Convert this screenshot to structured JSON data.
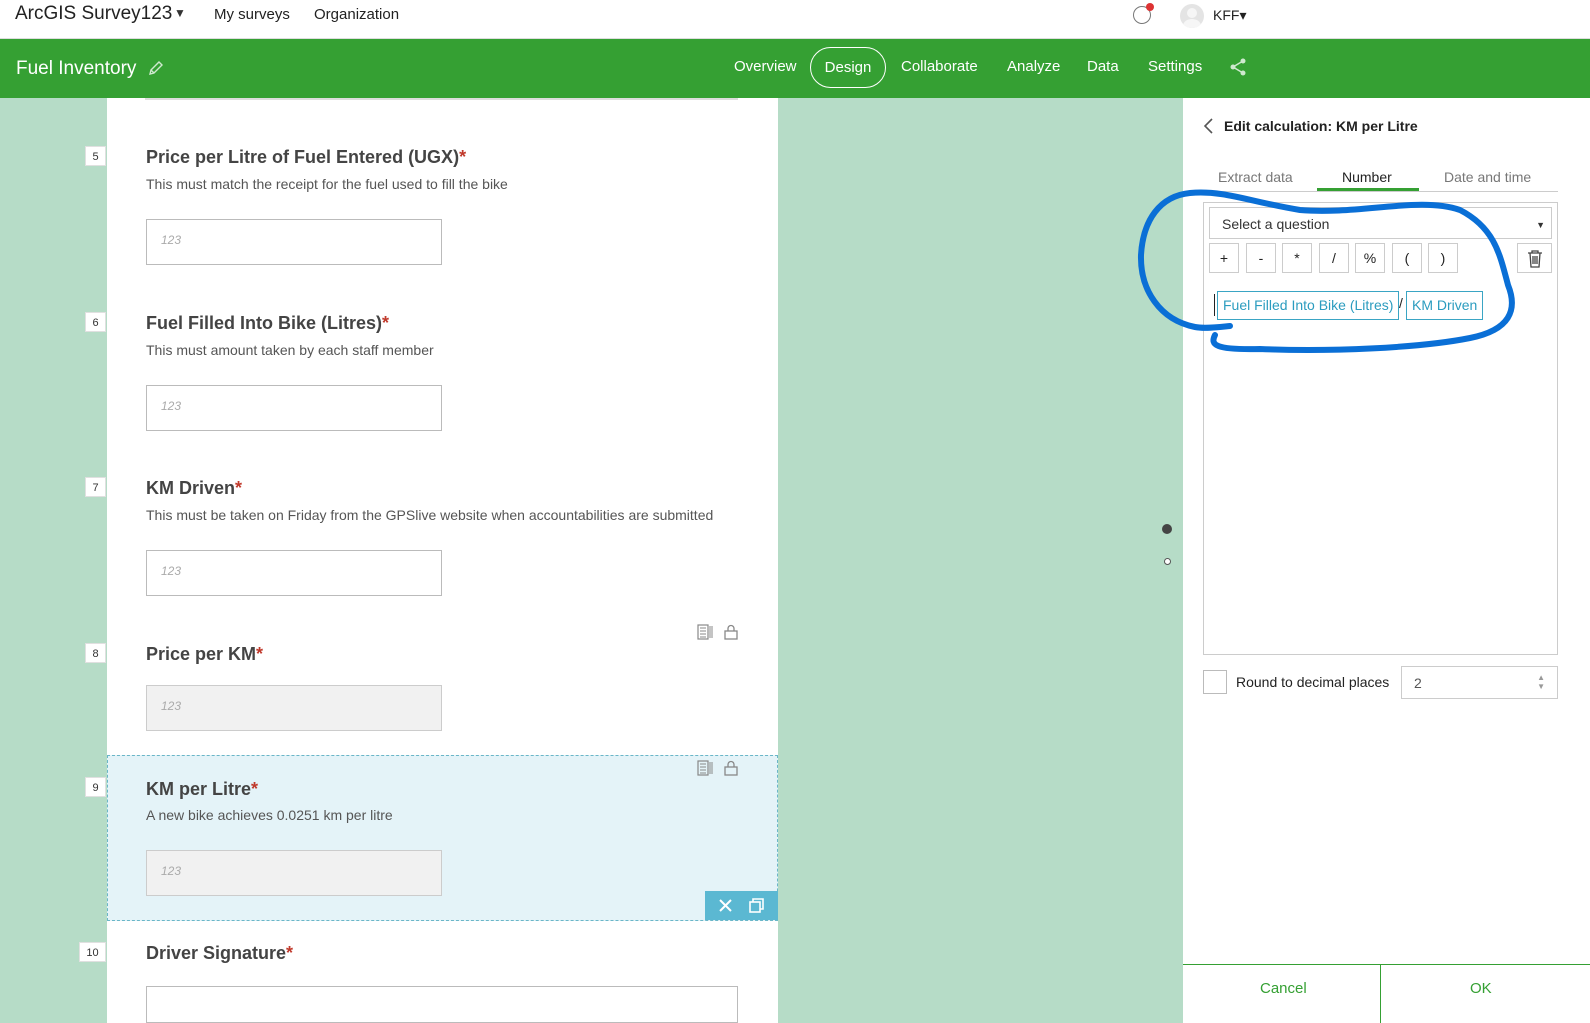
{
  "topbar": {
    "app_title": "ArcGIS Survey123",
    "nav": [
      "My surveys",
      "Organization"
    ],
    "user": "KFF"
  },
  "header": {
    "survey_name": "Fuel Inventory",
    "tabs": [
      "Overview",
      "Design",
      "Collaborate",
      "Analyze",
      "Data",
      "Settings"
    ],
    "active_tab": "Design",
    "accent_color": "#35a033"
  },
  "questions": [
    {
      "num": "5",
      "title": "Price per Litre of Fuel Entered (UGX)",
      "hint": "This must match the receipt for the fuel used to fill the bike"
    },
    {
      "num": "6",
      "title": "Fuel Filled Into Bike (Litres)",
      "hint": "This must amount taken by each staff member"
    },
    {
      "num": "7",
      "title": "KM Driven",
      "hint": "This must be taken on Friday from the GPSlive website when accountabilities are submitted"
    },
    {
      "num": "8",
      "title": "Price per KM",
      "hint": ""
    },
    {
      "num": "9",
      "title": "KM per Litre",
      "hint": "A new bike achieves 0.0251 km per litre"
    },
    {
      "num": "10",
      "title": "Driver Signature",
      "hint": ""
    }
  ],
  "required_mark": "*",
  "number_icon": "123",
  "panel": {
    "title": "Edit calculation: KM per Litre",
    "tabs": [
      "Extract data",
      "Number",
      "Date and time"
    ],
    "active_tab": "Number",
    "select_placeholder": "Select a question",
    "operators": [
      "+",
      "-",
      "*",
      "/",
      "%",
      "(",
      ")"
    ],
    "expression": {
      "left": "Fuel Filled Into Bike (Litres)",
      "operator": "/",
      "right": "KM Driven"
    },
    "round_label": "Round to decimal places",
    "round_value": "2",
    "cancel_label": "Cancel",
    "ok_label": "OK"
  },
  "annotation_color": "#0a6fd6"
}
